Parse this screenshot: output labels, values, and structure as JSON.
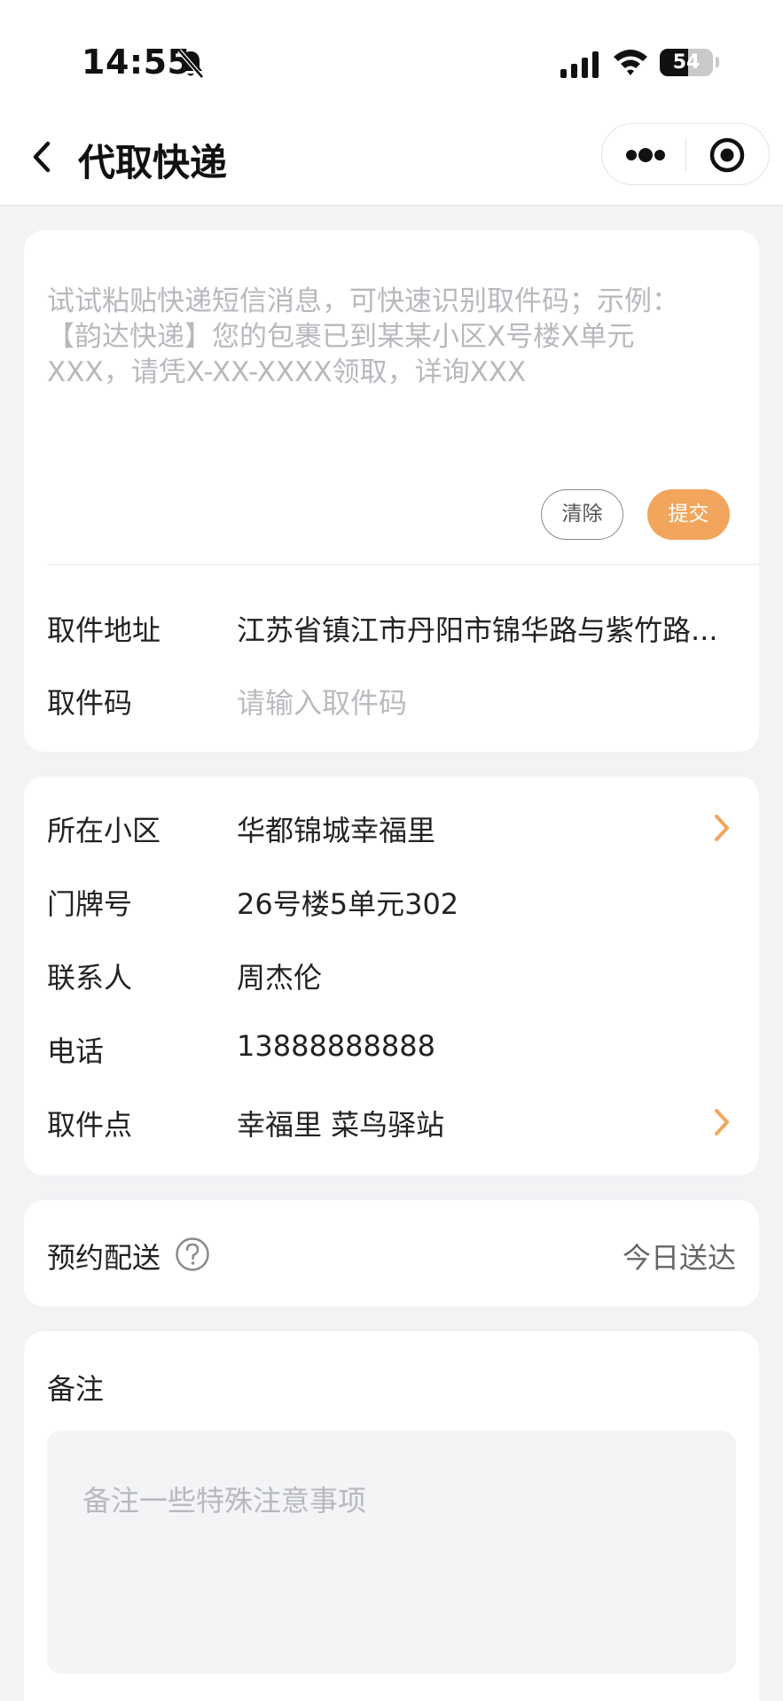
{
  "status_bar": {
    "time": "14:55",
    "battery_text": "54",
    "battery_level": 0.54
  },
  "nav": {
    "title": "代取快递",
    "icons": [
      "chevron-left-icon",
      "more-dots-icon",
      "target-icon"
    ]
  },
  "paste": {
    "placeholder": "试试粘贴快递短信消息，可快速识别取件码；示例：\n【韵达快递】您的包裹已到某某小区X号楼X单元\nXXX，请凭X-XX-XXXX领取，详询XXX",
    "clear_label": "清除",
    "submit_label": "提交"
  },
  "pickup": {
    "address_label": "取件地址",
    "address_value": "江苏省镇江市丹阳市锦华路与紫竹路...",
    "code_label": "取件码",
    "code_placeholder": "请输入取件码"
  },
  "info": {
    "community_label": "所在小区",
    "community_value": "华都锦城幸福里",
    "door_label": "门牌号",
    "door_value": "26号楼5单元302",
    "contact_label": "联系人",
    "contact_value": "周杰伦",
    "phone_label": "电话",
    "phone_value": "13888888888",
    "point_label": "取件点",
    "point_value": "幸福里 菜鸟驿站"
  },
  "schedule": {
    "label": "预约配送",
    "value": "今日送达"
  },
  "remark": {
    "label": "备注",
    "placeholder": "备注一些特殊注意事项"
  },
  "colors": {
    "accent": "#f2a55c",
    "background": "#f2f3f5",
    "placeholder": "#b7b9be"
  }
}
